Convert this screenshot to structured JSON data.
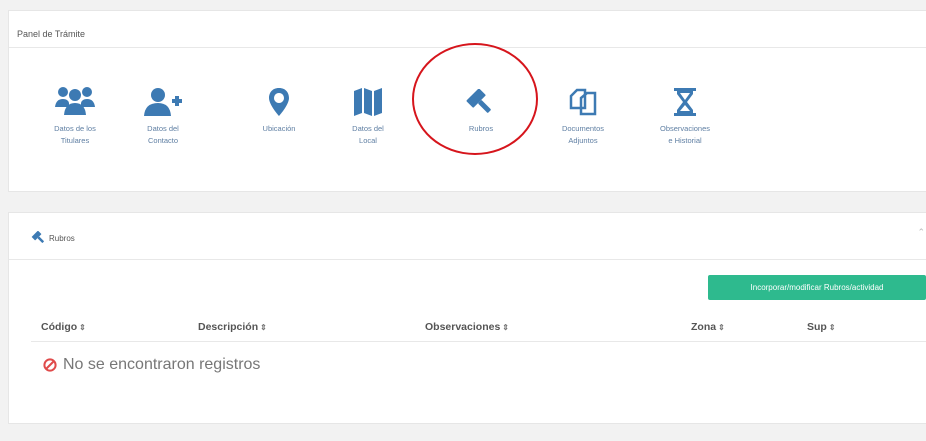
{
  "panel_tramite": {
    "title": "Panel de Trámite",
    "items": [
      {
        "label": "Datos de los\nTitulares",
        "icon": "users-icon"
      },
      {
        "label": "Datos del\nContacto",
        "icon": "user-plus-icon"
      },
      {
        "label": "Ubicación",
        "icon": "map-marker-icon"
      },
      {
        "label": "Datos del\nLocal",
        "icon": "map-icon"
      },
      {
        "label": "Rubros",
        "icon": "gavel-icon"
      },
      {
        "label": "Documentos\nAdjuntos",
        "icon": "files-icon"
      },
      {
        "label": "Observaciones\ne Historial",
        "icon": "hourglass-icon"
      }
    ]
  },
  "rubros": {
    "title": "Rubros",
    "add_button": "Incorporar/modificar Rubros/actividad",
    "sort_glyph": "⇕",
    "columns": [
      "Código",
      "Descripción",
      "Observaciones",
      "Zona",
      "Sup"
    ],
    "empty_message": "No se encontraron registros"
  },
  "colors": {
    "icon_blue": "#3d7ab3",
    "label_blue": "#5f7fa3",
    "button_green": "#2eba8e",
    "annotation_red": "#d6151c",
    "empty_red": "#e04b4b"
  }
}
